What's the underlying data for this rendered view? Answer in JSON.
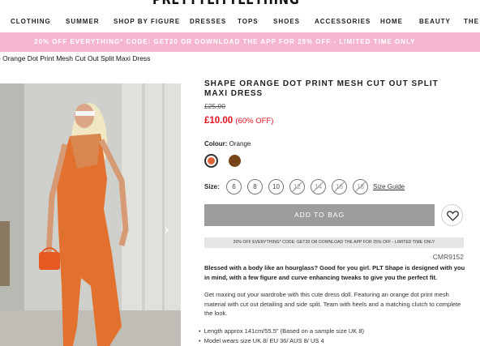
{
  "brand": {
    "logo": "PRETTYLITTLETHING"
  },
  "nav": {
    "items": [
      "CLOTHING",
      "SUMMER",
      "SHOP BY FIGURE",
      "DRESSES",
      "TOPS",
      "SHOES",
      "ACCESSORIES",
      "HOME",
      "BEAUTY",
      "THE E"
    ]
  },
  "promo": {
    "text": "20% OFF EVERYTHING* CODE: GET20 OR DOWNLOAD THE APP FOR 25% OFF - LIMITED TIME ONLY"
  },
  "breadcrumb": {
    "text": "e Orange Dot Print Mesh Cut Out Split Maxi Dress"
  },
  "product": {
    "title": "SHAPE ORANGE DOT PRINT MESH CUT OUT SPLIT MAXI DRESS",
    "old_price": "£25.00",
    "new_price": "£10.00",
    "discount": "(60% OFF)",
    "colour_label": "Colour:",
    "colour_value": "Orange",
    "colours": [
      {
        "name": "Orange",
        "hex": "#e2623a",
        "selected": true
      },
      {
        "name": "Brown",
        "hex": "#7a4516",
        "selected": false
      }
    ],
    "size_label": "Size:",
    "sizes": [
      {
        "label": "6",
        "available": true
      },
      {
        "label": "8",
        "available": true
      },
      {
        "label": "10",
        "available": true
      },
      {
        "label": "12",
        "available": false
      },
      {
        "label": "14",
        "available": false
      },
      {
        "label": "16",
        "available": false
      },
      {
        "label": "18",
        "available": false
      }
    ],
    "size_guide": "Size Guide",
    "add_to_bag": "ADD TO BAG",
    "promo_strip": "20% OFF EVERYTHING* CODE: GET20 OR DOWNLOAD THE APP FOR 25% OFF - LIMITED TIME ONLY",
    "code": "CMR9152",
    "desc_bold": "Blessed with a body like an hourglass? Good for you girl. PLT Shape is designed with you in mind, with a few figure and curve enhancing tweaks to give you the perfect fit.",
    "desc": "Get maxing out your wardrobe with this cute dress doll. Featuring an orange dot print mesh material with cut out detailing and side split. Team with heels and a matching clutch to complete the look.",
    "bullets": [
      "Length approx 141cm/55.5\" (Based on a sample size UK 8)",
      "Model wears size UK 8/ EU 36/ AUS 8/ US 4"
    ]
  },
  "colors": {
    "promo_bg": "#f4b7cf",
    "sale_red": "#e0111c",
    "button_grey": "#9c9c9c"
  }
}
